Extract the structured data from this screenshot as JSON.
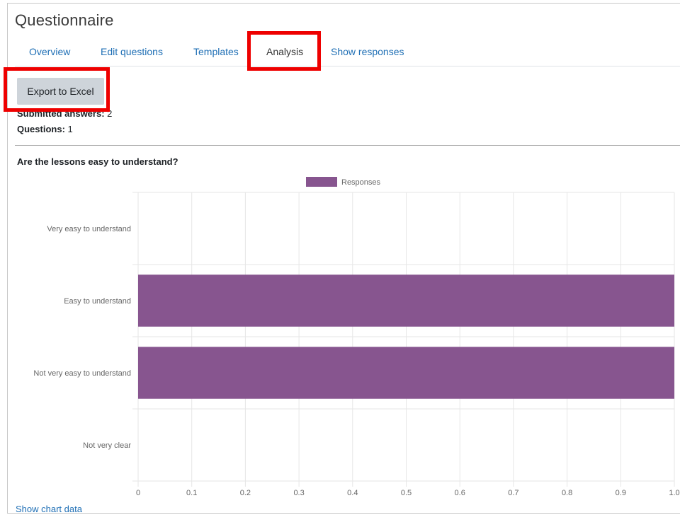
{
  "page": {
    "title": "Questionnaire",
    "tabs": [
      {
        "label": "Overview"
      },
      {
        "label": "Edit questions"
      },
      {
        "label": "Templates"
      },
      {
        "label": "Analysis"
      },
      {
        "label": "Show responses"
      }
    ],
    "export_button": "Export to Excel",
    "submitted_label": "Submitted answers:",
    "submitted_value": "2",
    "questions_label": "Questions:",
    "questions_value": "1",
    "question_title": "Are the lessons easy to understand?",
    "show_chart_data": "Show chart data"
  },
  "colors": {
    "bar": "#87558f",
    "link": "#1f6fb5",
    "highlight": "#ee0000"
  },
  "chart_data": {
    "type": "bar",
    "orientation": "horizontal",
    "categories": [
      "Very easy to understand",
      "Easy to understand",
      "Not very easy to understand",
      "Not very clear"
    ],
    "series": [
      {
        "name": "Responses",
        "values": [
          0,
          1,
          1,
          0
        ]
      }
    ],
    "xlim": [
      0,
      1.0
    ],
    "x_ticks": [
      "0",
      "0.1",
      "0.2",
      "0.3",
      "0.4",
      "0.5",
      "0.6",
      "0.7",
      "0.8",
      "0.9",
      "1.0"
    ],
    "grid": true,
    "legend": "top-center"
  }
}
